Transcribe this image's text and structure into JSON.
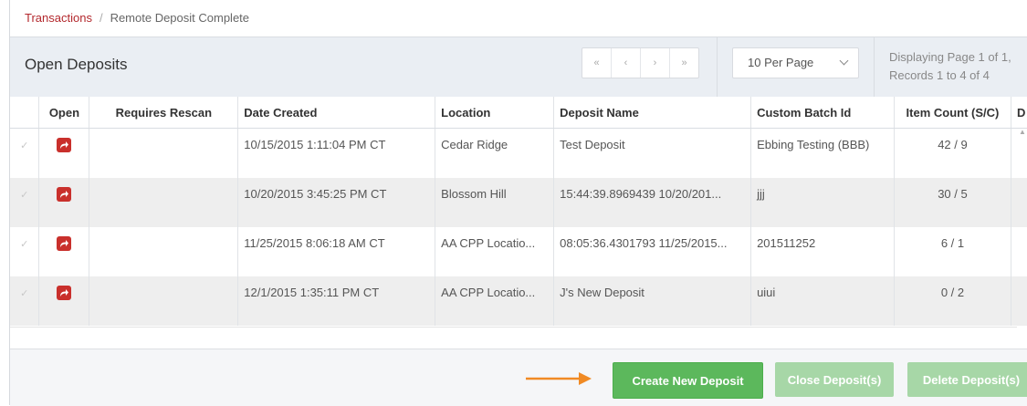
{
  "breadcrumb": {
    "root": "Transactions",
    "separator": "/",
    "current": "Remote Deposit Complete"
  },
  "panel": {
    "title": "Open Deposits"
  },
  "pagination": {
    "first": "«",
    "prev": "‹",
    "next": "›",
    "last": "»"
  },
  "per_page": {
    "selected": "10 Per Page"
  },
  "display_info": {
    "line1": "Displaying Page 1 of 1,",
    "line2": "Records 1 to 4 of 4"
  },
  "table": {
    "columns": [
      "Open",
      "Requires Rescan",
      "Date Created",
      "Location",
      "Deposit Name",
      "Custom Batch Id",
      "Item Count (S/C)",
      "D"
    ],
    "rows": [
      {
        "date_created": "10/15/2015 1:11:04 PM CT",
        "location": "Cedar Ridge",
        "deposit_name": "Test Deposit",
        "custom_batch_id": "Ebbing Testing (BBB)",
        "item_count": "42 / 9"
      },
      {
        "date_created": "10/20/2015 3:45:25 PM CT",
        "location": "Blossom Hill",
        "deposit_name": "15:44:39.8969439 10/20/201...",
        "custom_batch_id": "jjj",
        "item_count": "30 / 5"
      },
      {
        "date_created": "11/25/2015 8:06:18 AM CT",
        "location": "AA CPP Locatio...",
        "deposit_name": "08:05:36.4301793 11/25/2015...",
        "custom_batch_id": "201511252",
        "item_count": "6 / 1"
      },
      {
        "date_created": "12/1/2015 1:35:11 PM CT",
        "location": "AA CPP Locatio...",
        "deposit_name": "J's New Deposit",
        "custom_batch_id": "uiui",
        "item_count": "0 / 2"
      }
    ]
  },
  "footer": {
    "create": "Create New Deposit",
    "close": "Close Deposit(s)",
    "delete": "Delete Deposit(s)"
  },
  "colors": {
    "accent_red": "#c9302c",
    "green": "#5cb85c",
    "green_disabled": "#a7d7a7",
    "arrow": "#f08a24"
  }
}
